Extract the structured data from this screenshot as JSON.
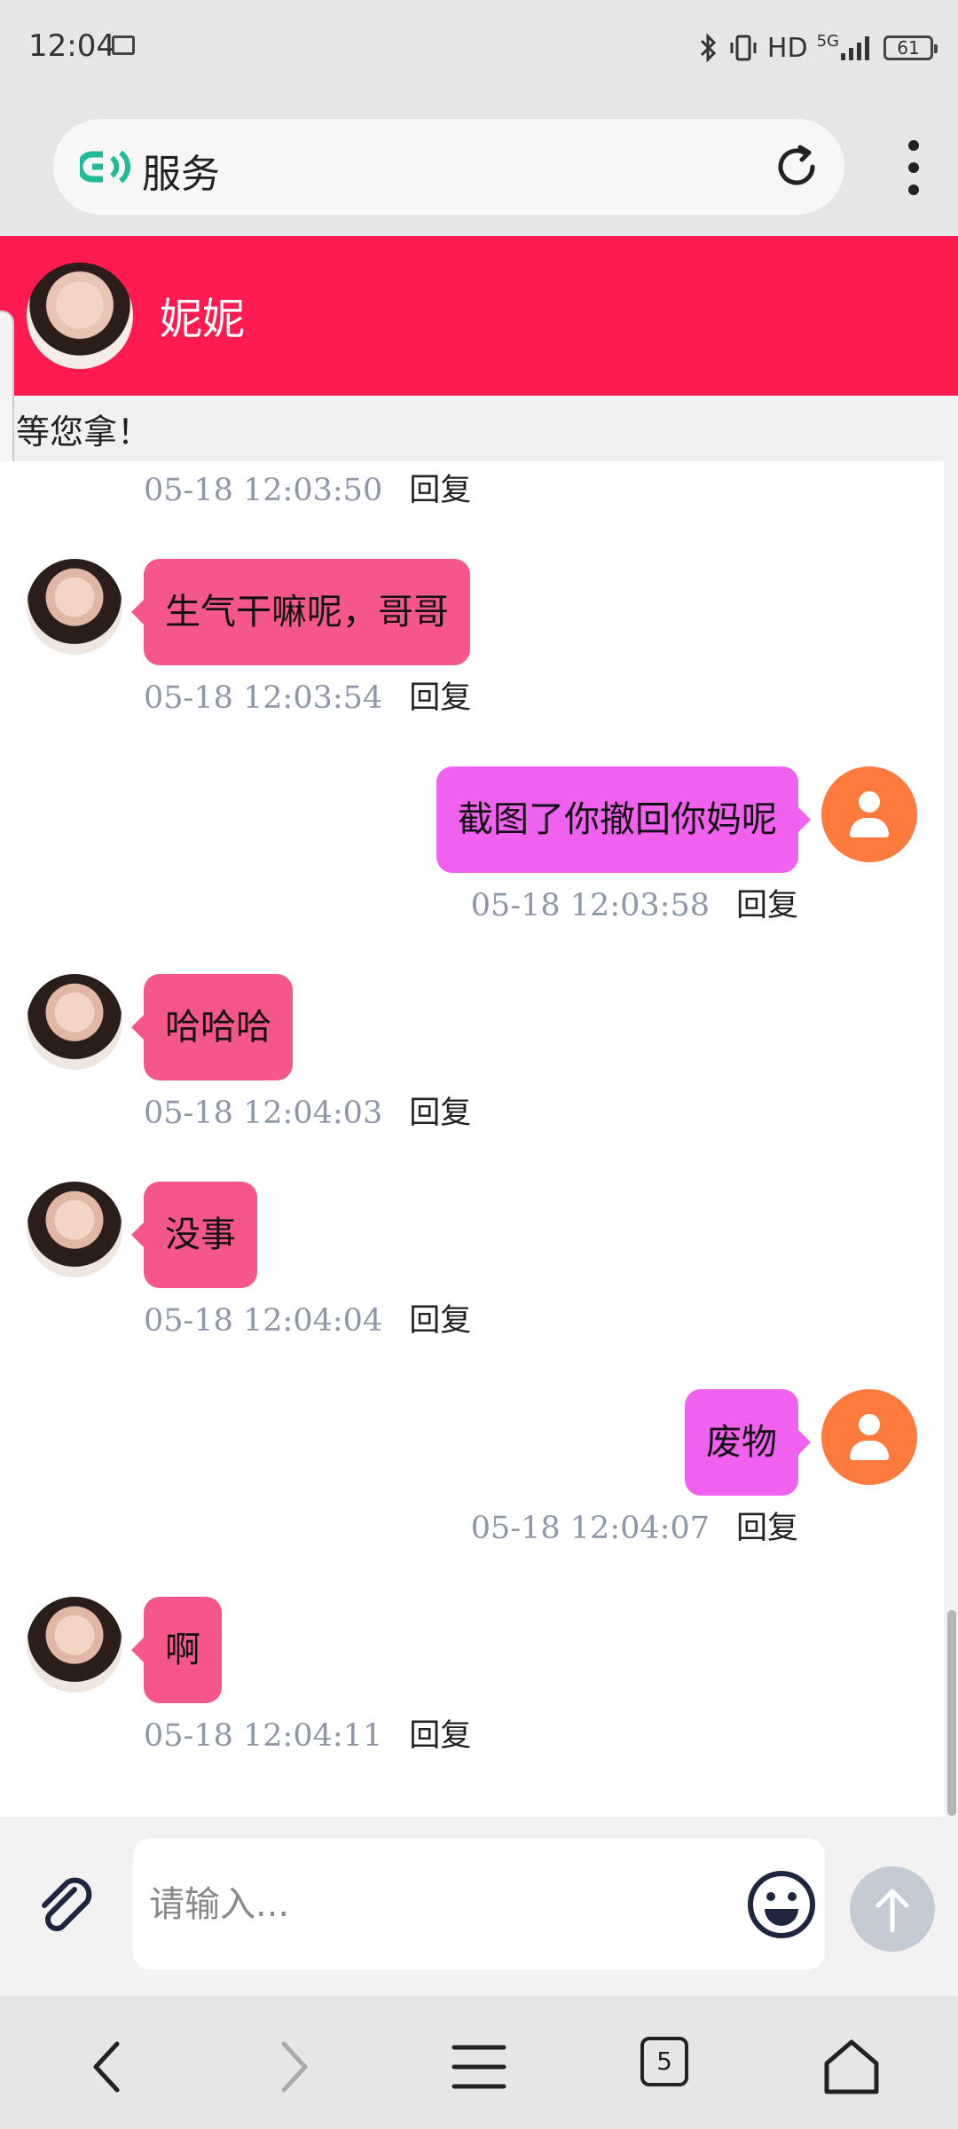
{
  "status_bar": {
    "time": "12:04",
    "hd_label": "HD",
    "network": "5G",
    "battery": "61"
  },
  "browser": {
    "page_title": "服务",
    "icons": [
      "logo-icon",
      "reload-icon",
      "more-vert-icon"
    ]
  },
  "chat_header": {
    "contact_name": "妮妮"
  },
  "notice": {
    "text": "奖等您拿！"
  },
  "messages": [
    {
      "side": "left",
      "text": "",
      "time": "05-18 12:03:50",
      "reply": "回复"
    },
    {
      "side": "left",
      "text": "生气干嘛呢，哥哥",
      "time": "05-18 12:03:54",
      "reply": "回复"
    },
    {
      "side": "right",
      "text": "截图了你撤回你妈呢",
      "time": "05-18 12:03:58",
      "reply": "回复"
    },
    {
      "side": "left",
      "text": "哈哈哈",
      "time": "05-18 12:04:03",
      "reply": "回复"
    },
    {
      "side": "left",
      "text": "没事",
      "time": "05-18 12:04:04",
      "reply": "回复"
    },
    {
      "side": "right",
      "text": "废物",
      "time": "05-18 12:04:07",
      "reply": "回复"
    },
    {
      "side": "left",
      "text": "啊",
      "time": "05-18 12:04:11",
      "reply": "回复"
    }
  ],
  "composer": {
    "placeholder": "请输入..."
  },
  "nav": {
    "tab_count": "5"
  },
  "colors": {
    "header": "#ff1a50",
    "bubble_incoming": "#f5578a",
    "bubble_outgoing": "#f061f0",
    "my_avatar": "#ff7a3d"
  }
}
